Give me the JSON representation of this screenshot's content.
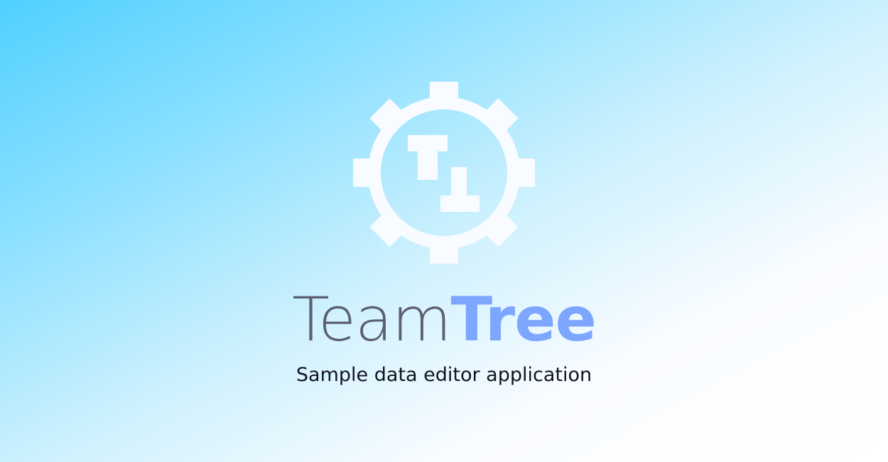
{
  "brand": {
    "title_part_1": "Team",
    "title_part_2": "Tree",
    "tagline": "Sample data editor application",
    "logo_icon": "gear-tt-logo-icon",
    "colors": {
      "title_light": "#5c6171",
      "title_accent": "#7da6ff",
      "tagline": "#101422",
      "logo": "#f8fbff",
      "background_start": "#50d0ff",
      "background_end": "#ffffff"
    }
  }
}
